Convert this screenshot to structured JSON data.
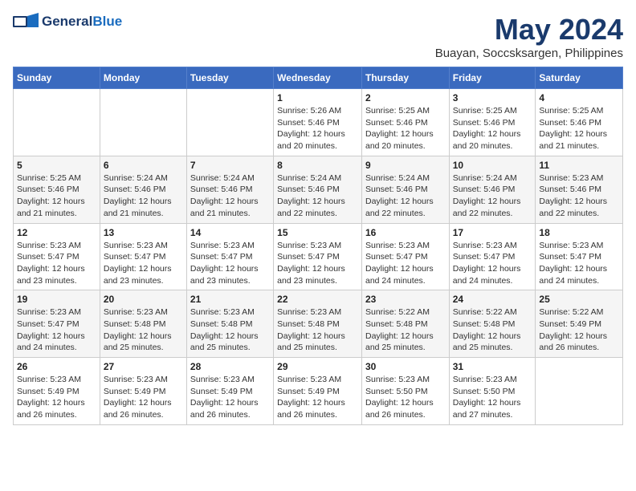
{
  "header": {
    "logo_line1": "General",
    "logo_line2": "Blue",
    "month": "May 2024",
    "location": "Buayan, Soccsksargen, Philippines"
  },
  "days_of_week": [
    "Sunday",
    "Monday",
    "Tuesday",
    "Wednesday",
    "Thursday",
    "Friday",
    "Saturday"
  ],
  "weeks": [
    [
      {
        "day": "",
        "info": ""
      },
      {
        "day": "",
        "info": ""
      },
      {
        "day": "",
        "info": ""
      },
      {
        "day": "1",
        "info": "Sunrise: 5:26 AM\nSunset: 5:46 PM\nDaylight: 12 hours\nand 20 minutes."
      },
      {
        "day": "2",
        "info": "Sunrise: 5:25 AM\nSunset: 5:46 PM\nDaylight: 12 hours\nand 20 minutes."
      },
      {
        "day": "3",
        "info": "Sunrise: 5:25 AM\nSunset: 5:46 PM\nDaylight: 12 hours\nand 20 minutes."
      },
      {
        "day": "4",
        "info": "Sunrise: 5:25 AM\nSunset: 5:46 PM\nDaylight: 12 hours\nand 21 minutes."
      }
    ],
    [
      {
        "day": "5",
        "info": "Sunrise: 5:25 AM\nSunset: 5:46 PM\nDaylight: 12 hours\nand 21 minutes."
      },
      {
        "day": "6",
        "info": "Sunrise: 5:24 AM\nSunset: 5:46 PM\nDaylight: 12 hours\nand 21 minutes."
      },
      {
        "day": "7",
        "info": "Sunrise: 5:24 AM\nSunset: 5:46 PM\nDaylight: 12 hours\nand 21 minutes."
      },
      {
        "day": "8",
        "info": "Sunrise: 5:24 AM\nSunset: 5:46 PM\nDaylight: 12 hours\nand 22 minutes."
      },
      {
        "day": "9",
        "info": "Sunrise: 5:24 AM\nSunset: 5:46 PM\nDaylight: 12 hours\nand 22 minutes."
      },
      {
        "day": "10",
        "info": "Sunrise: 5:24 AM\nSunset: 5:46 PM\nDaylight: 12 hours\nand 22 minutes."
      },
      {
        "day": "11",
        "info": "Sunrise: 5:23 AM\nSunset: 5:46 PM\nDaylight: 12 hours\nand 22 minutes."
      }
    ],
    [
      {
        "day": "12",
        "info": "Sunrise: 5:23 AM\nSunset: 5:47 PM\nDaylight: 12 hours\nand 23 minutes."
      },
      {
        "day": "13",
        "info": "Sunrise: 5:23 AM\nSunset: 5:47 PM\nDaylight: 12 hours\nand 23 minutes."
      },
      {
        "day": "14",
        "info": "Sunrise: 5:23 AM\nSunset: 5:47 PM\nDaylight: 12 hours\nand 23 minutes."
      },
      {
        "day": "15",
        "info": "Sunrise: 5:23 AM\nSunset: 5:47 PM\nDaylight: 12 hours\nand 23 minutes."
      },
      {
        "day": "16",
        "info": "Sunrise: 5:23 AM\nSunset: 5:47 PM\nDaylight: 12 hours\nand 24 minutes."
      },
      {
        "day": "17",
        "info": "Sunrise: 5:23 AM\nSunset: 5:47 PM\nDaylight: 12 hours\nand 24 minutes."
      },
      {
        "day": "18",
        "info": "Sunrise: 5:23 AM\nSunset: 5:47 PM\nDaylight: 12 hours\nand 24 minutes."
      }
    ],
    [
      {
        "day": "19",
        "info": "Sunrise: 5:23 AM\nSunset: 5:47 PM\nDaylight: 12 hours\nand 24 minutes."
      },
      {
        "day": "20",
        "info": "Sunrise: 5:23 AM\nSunset: 5:48 PM\nDaylight: 12 hours\nand 25 minutes."
      },
      {
        "day": "21",
        "info": "Sunrise: 5:23 AM\nSunset: 5:48 PM\nDaylight: 12 hours\nand 25 minutes."
      },
      {
        "day": "22",
        "info": "Sunrise: 5:23 AM\nSunset: 5:48 PM\nDaylight: 12 hours\nand 25 minutes."
      },
      {
        "day": "23",
        "info": "Sunrise: 5:22 AM\nSunset: 5:48 PM\nDaylight: 12 hours\nand 25 minutes."
      },
      {
        "day": "24",
        "info": "Sunrise: 5:22 AM\nSunset: 5:48 PM\nDaylight: 12 hours\nand 25 minutes."
      },
      {
        "day": "25",
        "info": "Sunrise: 5:22 AM\nSunset: 5:49 PM\nDaylight: 12 hours\nand 26 minutes."
      }
    ],
    [
      {
        "day": "26",
        "info": "Sunrise: 5:23 AM\nSunset: 5:49 PM\nDaylight: 12 hours\nand 26 minutes."
      },
      {
        "day": "27",
        "info": "Sunrise: 5:23 AM\nSunset: 5:49 PM\nDaylight: 12 hours\nand 26 minutes."
      },
      {
        "day": "28",
        "info": "Sunrise: 5:23 AM\nSunset: 5:49 PM\nDaylight: 12 hours\nand 26 minutes."
      },
      {
        "day": "29",
        "info": "Sunrise: 5:23 AM\nSunset: 5:49 PM\nDaylight: 12 hours\nand 26 minutes."
      },
      {
        "day": "30",
        "info": "Sunrise: 5:23 AM\nSunset: 5:50 PM\nDaylight: 12 hours\nand 26 minutes."
      },
      {
        "day": "31",
        "info": "Sunrise: 5:23 AM\nSunset: 5:50 PM\nDaylight: 12 hours\nand 27 minutes."
      },
      {
        "day": "",
        "info": ""
      }
    ]
  ]
}
